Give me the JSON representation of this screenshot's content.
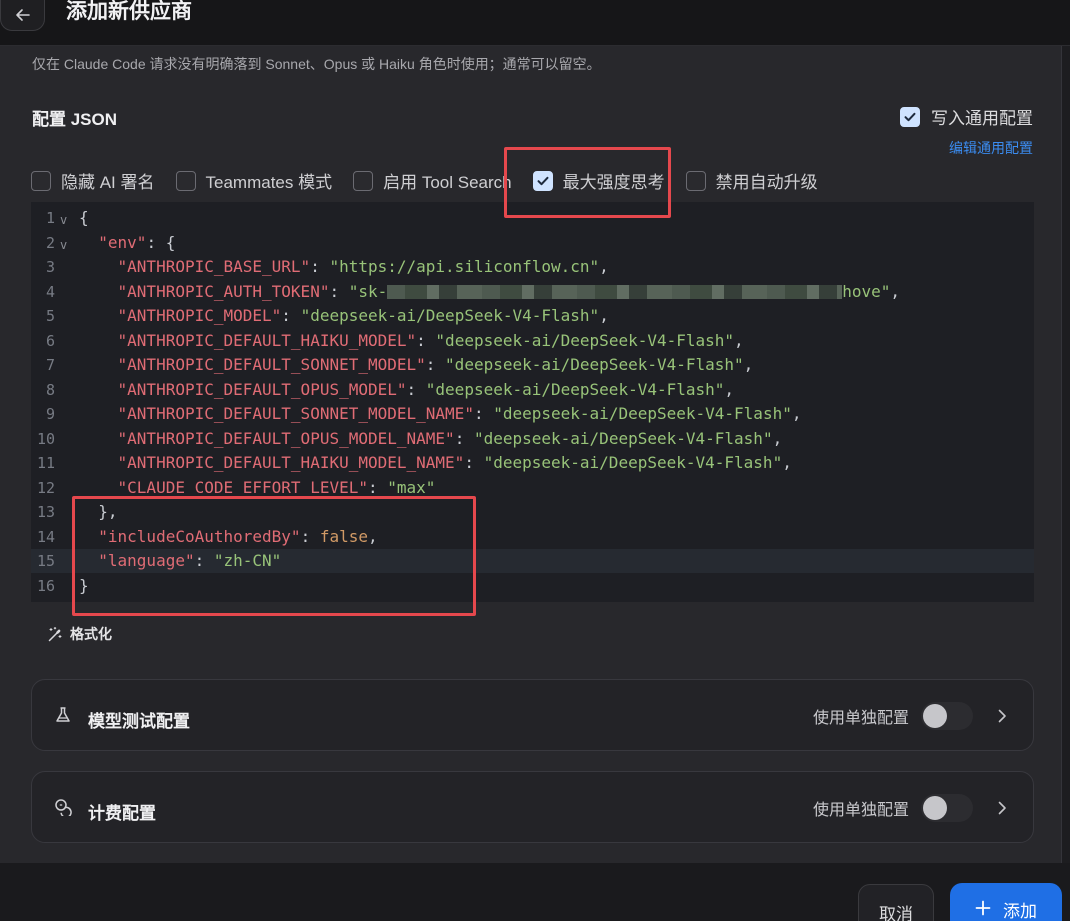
{
  "header": {
    "title": "添加新供应商",
    "back_icon": "arrow-left-icon"
  },
  "hint": "仅在 Claude Code 请求没有明确落到 Sonnet、Opus 或 Haiku 角色时使用；通常可以留空。",
  "config": {
    "title": "配置 JSON",
    "write_common_label": "写入通用配置",
    "write_common_checked": true,
    "edit_common_label": "编辑通用配置",
    "options": [
      {
        "label": "隐藏 AI 署名",
        "checked": false
      },
      {
        "label": "Teammates 模式",
        "checked": false
      },
      {
        "label": "启用 Tool Search",
        "checked": false
      },
      {
        "label": "最大强度思考",
        "checked": true
      },
      {
        "label": "禁用自动升级",
        "checked": false
      }
    ]
  },
  "editor": {
    "lines": [
      {
        "n": "1",
        "fold": true,
        "indent": "",
        "key": "",
        "value": "",
        "vtype": "",
        "pre": "{",
        "post": ""
      },
      {
        "n": "2",
        "fold": true,
        "indent": "  ",
        "key": "\"env\"",
        "value": "",
        "vtype": "",
        "pre": "",
        "post": ": {"
      },
      {
        "n": "3",
        "fold": false,
        "indent": "    ",
        "key": "\"ANTHROPIC_BASE_URL\"",
        "value": "\"https://api.siliconflow.cn\"",
        "vtype": "s",
        "pre": "",
        "post": ","
      },
      {
        "n": "4",
        "fold": false,
        "indent": "    ",
        "key": "\"ANTHROPIC_AUTH_TOKEN\"",
        "value": "\"sk-",
        "vtype": "s",
        "blur": true,
        "tail": "hove\"",
        "pre": "",
        "post": ","
      },
      {
        "n": "5",
        "fold": false,
        "indent": "    ",
        "key": "\"ANTHROPIC_MODEL\"",
        "value": "\"deepseek-ai/DeepSeek-V4-Flash\"",
        "vtype": "s",
        "pre": "",
        "post": ","
      },
      {
        "n": "6",
        "fold": false,
        "indent": "    ",
        "key": "\"ANTHROPIC_DEFAULT_HAIKU_MODEL\"",
        "value": "\"deepseek-ai/DeepSeek-V4-Flash\"",
        "vtype": "s",
        "pre": "",
        "post": ","
      },
      {
        "n": "7",
        "fold": false,
        "indent": "    ",
        "key": "\"ANTHROPIC_DEFAULT_SONNET_MODEL\"",
        "value": "\"deepseek-ai/DeepSeek-V4-Flash\"",
        "vtype": "s",
        "pre": "",
        "post": ","
      },
      {
        "n": "8",
        "fold": false,
        "indent": "    ",
        "key": "\"ANTHROPIC_DEFAULT_OPUS_MODEL\"",
        "value": "\"deepseek-ai/DeepSeek-V4-Flash\"",
        "vtype": "s",
        "pre": "",
        "post": ","
      },
      {
        "n": "9",
        "fold": false,
        "indent": "    ",
        "key": "\"ANTHROPIC_DEFAULT_SONNET_MODEL_NAME\"",
        "value": "\"deepseek-ai/DeepSeek-V4-Flash\"",
        "vtype": "s",
        "pre": "",
        "post": ","
      },
      {
        "n": "10",
        "fold": false,
        "indent": "    ",
        "key": "\"ANTHROPIC_DEFAULT_OPUS_MODEL_NAME\"",
        "value": "\"deepseek-ai/DeepSeek-V4-Flash\"",
        "vtype": "s",
        "pre": "",
        "post": ","
      },
      {
        "n": "11",
        "fold": false,
        "indent": "    ",
        "key": "\"ANTHROPIC_DEFAULT_HAIKU_MODEL_NAME\"",
        "value": "\"deepseek-ai/DeepSeek-V4-Flash\"",
        "vtype": "s",
        "pre": "",
        "post": ","
      },
      {
        "n": "12",
        "fold": false,
        "indent": "    ",
        "key": "\"CLAUDE_CODE_EFFORT_LEVEL\"",
        "value": "\"max\"",
        "vtype": "s",
        "pre": "",
        "post": ""
      },
      {
        "n": "13",
        "fold": false,
        "indent": "  ",
        "key": "",
        "value": "",
        "vtype": "",
        "pre": "},",
        "post": ""
      },
      {
        "n": "14",
        "fold": false,
        "indent": "  ",
        "key": "\"includeCoAuthoredBy\"",
        "value": "false",
        "vtype": "b",
        "pre": "",
        "post": ","
      },
      {
        "n": "15",
        "fold": false,
        "indent": "  ",
        "key": "\"language\"",
        "value": "\"zh-CN\"",
        "vtype": "s",
        "pre": "",
        "post": "",
        "active": true
      },
      {
        "n": "16",
        "fold": false,
        "indent": "",
        "key": "",
        "value": "",
        "vtype": "",
        "pre": "}",
        "post": ""
      }
    ],
    "format_label": "格式化"
  },
  "cards": [
    {
      "title": "模型测试配置",
      "icon": "flask-icon",
      "toggle_label": "使用单独配置",
      "enabled": false
    },
    {
      "title": "计费配置",
      "icon": "coins-icon",
      "toggle_label": "使用单独配置",
      "enabled": false
    }
  ],
  "footer": {
    "cancel_label": "取消",
    "add_label": "添加"
  },
  "colors": {
    "accent": "#1f6fe5",
    "link": "#3b8cf0",
    "highlight": "#e5484d"
  }
}
